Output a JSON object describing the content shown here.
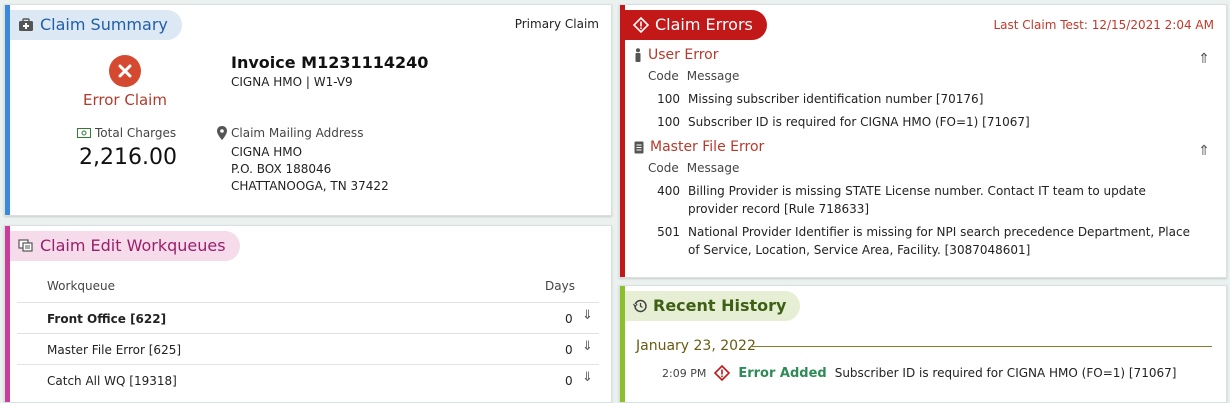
{
  "summary": {
    "title": "Claim Summary",
    "claim_type": "Primary Claim",
    "status_label": "Error Claim",
    "invoice": "Invoice M1231114240",
    "payer_line": "CIGNA HMO | W1-V9",
    "charges_label": "Total Charges",
    "charges_value": "2,216.00",
    "address_label": "Claim Mailing Address",
    "address_lines": [
      "CIGNA HMO",
      "P.O. BOX 188046",
      "CHATTANOOGA, TN 37422"
    ]
  },
  "workqueues": {
    "title": "Claim Edit Workqueues",
    "col_workqueue": "Workqueue",
    "col_days": "Days",
    "rows": [
      {
        "name": "Front Office [622]",
        "days": "0"
      },
      {
        "name": "Master File Error [625]",
        "days": "0"
      },
      {
        "name": "Catch All WQ [19318]",
        "days": "0"
      }
    ]
  },
  "errors": {
    "title": "Claim Errors",
    "last_test": "Last Claim Test: 12/15/2021 2:04 AM",
    "col_code": "Code",
    "col_message": "Message",
    "groups": [
      {
        "title": "User Error",
        "icon": "person-icon",
        "items": [
          {
            "code": "100",
            "message": "Missing subscriber identification number [70176]"
          },
          {
            "code": "100",
            "message": "Subscriber ID is required for CIGNA HMO (FO=1) [71067]"
          }
        ]
      },
      {
        "title": "Master File Error",
        "icon": "file-icon",
        "items": [
          {
            "code": "400",
            "message": "Billing Provider is missing STATE License number. Contact IT team to update provider record [Rule 718633]"
          },
          {
            "code": "501",
            "message": "National Provider Identifier is missing for NPI search precedence Department, Place of Service, Location, Service Area, Facility. [3087048601]"
          }
        ]
      }
    ]
  },
  "history": {
    "title": "Recent History",
    "date": "January 23, 2022",
    "entries": [
      {
        "time": "2:09 PM",
        "action": "Error Added",
        "message": "Subscriber ID is required for CIGNA HMO (FO=1) [71067]"
      }
    ]
  },
  "colors": {
    "summary_accent": "#3a8ad9",
    "workqueue_accent": "#c83e9b",
    "errors_accent": "#c21818",
    "history_accent": "#8cbf2a"
  }
}
